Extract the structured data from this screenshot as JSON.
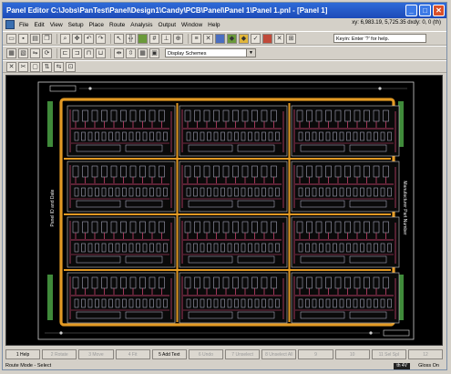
{
  "window": {
    "title": "Panel Editor  C:\\Jobs\\PanTest\\Panel\\Design1\\Candy\\PCB\\Panel\\Panel 1\\Panel 1.pnl - [Panel 1]"
  },
  "menu": {
    "items": [
      "File",
      "Edit",
      "View",
      "Setup",
      "Place",
      "Route",
      "Analysis",
      "Output",
      "Window",
      "Help"
    ],
    "coords": "xy: 6,983.19, 5,725.35   dxdy: 0, 0 (th)"
  },
  "toolbar2": {
    "keyin_placeholder": "Keyin: Enter '?' for help."
  },
  "toolbar3": {
    "display_schemes": "Display Schemes"
  },
  "canvas": {
    "left_label": "Panel ID and Date",
    "right_label": "Manufacturer Part Number",
    "colors": {
      "background": "#000000",
      "panel_border": "#e39a24",
      "rail": "#3f8a3a",
      "board_outline": "#e39a24",
      "trace": "#e04a7a",
      "pad": "#c0c0d8"
    }
  },
  "fkeys": [
    {
      "label": "1 Help",
      "active": true
    },
    {
      "label": "2 Rotate",
      "active": false
    },
    {
      "label": "3 Move",
      "active": false
    },
    {
      "label": "4 Fit",
      "active": false
    },
    {
      "label": "5 Add Text",
      "active": true
    },
    {
      "label": "6 Undo",
      "active": false
    },
    {
      "label": "7 Unselect",
      "active": false
    },
    {
      "label": "8 Unselect All",
      "active": false
    },
    {
      "label": "9",
      "active": false
    },
    {
      "label": "10",
      "active": false
    },
    {
      "label": "11 Sel Spl",
      "active": false
    },
    {
      "label": "12",
      "active": false
    }
  ],
  "status": {
    "mode": "Route Mode - Select",
    "units": "th  4V",
    "gloss": "Gloss On"
  }
}
